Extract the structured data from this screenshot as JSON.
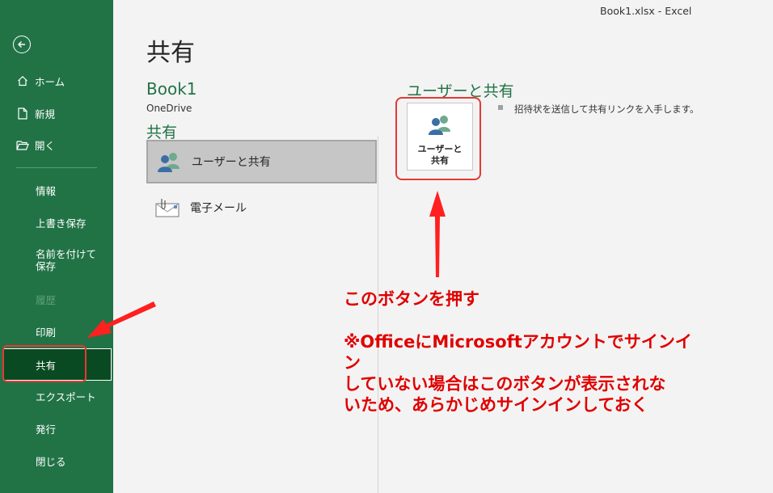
{
  "titlebar": {
    "text": "Book1.xlsx  -  Excel"
  },
  "sidebar": {
    "items": [
      {
        "label": "ホーム",
        "icon": "home-icon"
      },
      {
        "label": "新規",
        "icon": "new-document-icon"
      },
      {
        "label": "開く",
        "icon": "open-folder-icon"
      },
      {
        "label": "情報"
      },
      {
        "label": "上書き保存"
      },
      {
        "label": "名前を付けて保存"
      },
      {
        "label": "履歴",
        "disabled": true
      },
      {
        "label": "印刷"
      },
      {
        "label": "共有",
        "selected": true
      },
      {
        "label": "エクスポート"
      },
      {
        "label": "発行"
      },
      {
        "label": "閉じる"
      }
    ],
    "back_icon": "back-arrow-icon",
    "bg_color": "#217346",
    "selected_color": "#0a4a23"
  },
  "main": {
    "title": "共有",
    "book_title": "Book1",
    "book_location": "OneDrive",
    "section_title": "共有",
    "options": [
      {
        "label": "ユーザーと共有",
        "icon": "people-icon",
        "selected": true
      },
      {
        "label": "電子メール",
        "icon": "email-icon"
      }
    ]
  },
  "right_panel": {
    "title": "ユーザーと共有",
    "button_label_line1": "ユーザーと",
    "button_label_line2": "共有",
    "description": "招待状を送信して共有リンクを入手します。"
  },
  "annotations": {
    "primary": "このボタンを押す",
    "note_line1": "※OfficeにMicrosoftアカウントでサインイン",
    "note_line2": "していない場合はこのボタンが表示されな",
    "note_line3": "いため、あらかじめサインインしておく",
    "color": "#e00000"
  }
}
